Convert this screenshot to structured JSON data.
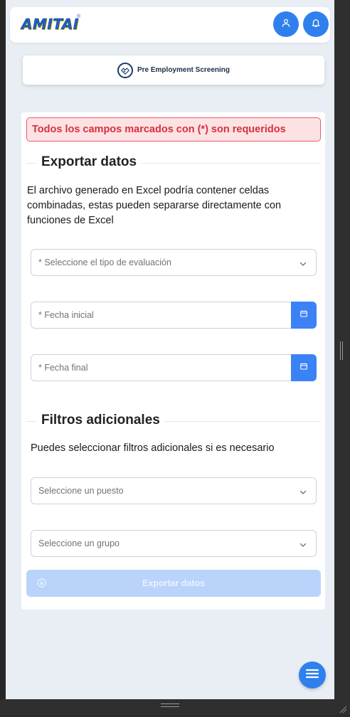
{
  "header": {
    "logo_text": "AMITAI",
    "logo_mark": "®",
    "user_icon": "user-icon",
    "notifications_icon": "bell-icon"
  },
  "service": {
    "label": "Pre Employment Screening",
    "icon": "handshake-icon"
  },
  "form": {
    "required_notice": "Todos los campos marcados con (*) son requeridos",
    "export_section": {
      "title": "Exportar datos",
      "description": " El archivo generado en Excel podría contener celdas combinadas, estas pueden separarse directamente con funciones de Excel",
      "evaluation_type_placeholder": "* Seleccione el tipo de evaluación",
      "start_date_placeholder": "* Fecha inicial",
      "end_date_placeholder": "* Fecha final"
    },
    "filters_section": {
      "title": "Filtros adicionales",
      "description": "Puedes seleccionar filtros adicionales si es necesario",
      "position_placeholder": "Seleccione un puesto",
      "group_placeholder": "Seleccione un grupo"
    },
    "export_button_label": "Exportar datos"
  },
  "colors": {
    "accent": "#2f80ed",
    "alert_text": "#d6313f",
    "alert_bg": "#fde2e4",
    "disabled_button": "#b9d3fb"
  },
  "fab": {
    "icon": "menu-icon"
  }
}
